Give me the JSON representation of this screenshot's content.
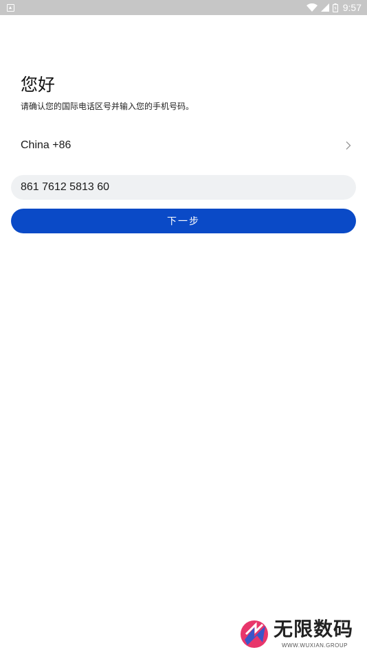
{
  "status_bar": {
    "time": "9:57",
    "icons": [
      "notification-icon",
      "wifi-icon",
      "signal-icon",
      "battery-icon"
    ]
  },
  "greeting": "您好",
  "subtitle": "请确认您的国际电话区号并输入您的手机号码。",
  "country": {
    "label": "China +86",
    "icon": "chevron-right-icon"
  },
  "phone": {
    "value": "861 7612 5813 60"
  },
  "next_button": {
    "label": "下一步"
  },
  "colors": {
    "accent": "#0a4ac7",
    "input_bg": "#eff1f3",
    "status_bar": "#c6c6c6"
  },
  "watermark": {
    "text": "无限数码",
    "sub": "WWW.WUXIAN.GROUP"
  }
}
